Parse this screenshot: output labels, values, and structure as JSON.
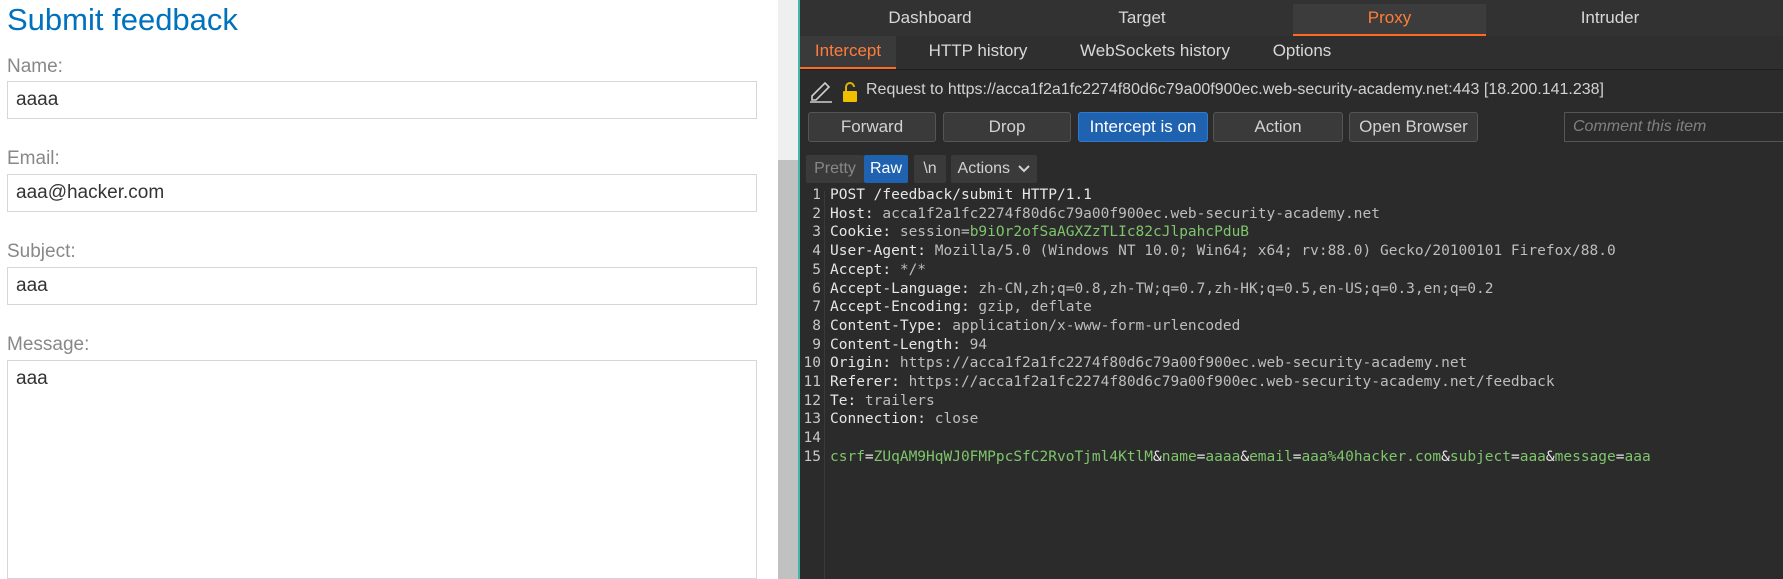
{
  "form": {
    "title": "Submit feedback",
    "name_label": "Name:",
    "name_value": "aaaa",
    "email_label": "Email:",
    "email_value": "aaa@hacker.com",
    "subject_label": "Subject:",
    "subject_value": "aaa",
    "message_label": "Message:",
    "message_value": "aaa"
  },
  "burp": {
    "main_tabs": [
      "Dashboard",
      "Target",
      "Proxy",
      "Intruder"
    ],
    "active_main_tab": "Proxy",
    "sub_tabs": [
      "Intercept",
      "HTTP history",
      "WebSockets history",
      "Options"
    ],
    "active_sub_tab": "Intercept",
    "request_info": "Request to https://acca1f2a1fc2274f80d6c79a00f900ec.web-security-academy.net:443  [18.200.141.238]",
    "buttons": {
      "forward": "Forward",
      "drop": "Drop",
      "intercept": "Intercept is on",
      "action": "Action",
      "open_browser": "Open Browser"
    },
    "comment_placeholder": "Comment this item",
    "editor_buttons": {
      "pretty": "Pretty",
      "raw": "Raw",
      "newline": "\\n",
      "actions": "Actions"
    },
    "request_lines": [
      {
        "n": "1",
        "key": "POST /feedback/submit HTTP/1.1",
        "val": ""
      },
      {
        "n": "2",
        "key": "Host:",
        "val": " acca1f2a1fc2274f80d6c79a00f900ec.web-security-academy.net"
      },
      {
        "n": "3",
        "key": "Cookie:",
        "val": " session=",
        "cookie": "b9iOr2ofSaAGXZzTLIc82cJlpahcPduB"
      },
      {
        "n": "4",
        "key": "User-Agent:",
        "val": " Mozilla/5.0 (Windows NT 10.0; Win64; x64; rv:88.0) Gecko/20100101 Firefox/88.0"
      },
      {
        "n": "5",
        "key": "Accept:",
        "val": " */*"
      },
      {
        "n": "6",
        "key": "Accept-Language:",
        "val": " zh-CN,zh;q=0.8,zh-TW;q=0.7,zh-HK;q=0.5,en-US;q=0.3,en;q=0.2"
      },
      {
        "n": "7",
        "key": "Accept-Encoding:",
        "val": " gzip, deflate"
      },
      {
        "n": "8",
        "key": "Content-Type:",
        "val": " application/x-www-form-urlencoded"
      },
      {
        "n": "9",
        "key": "Content-Length:",
        "val": " 94"
      },
      {
        "n": "10",
        "key": "Origin:",
        "val": " https://acca1f2a1fc2274f80d6c79a00f900ec.web-security-academy.net"
      },
      {
        "n": "11",
        "key": "Referer:",
        "val": " https://acca1f2a1fc2274f80d6c79a00f900ec.web-security-academy.net/feedback"
      },
      {
        "n": "12",
        "key": "Te:",
        "val": " trailers"
      },
      {
        "n": "13",
        "key": "Connection:",
        "val": " close"
      },
      {
        "n": "14",
        "key": "",
        "val": ""
      }
    ],
    "body_line_number": "15",
    "body_params": [
      {
        "k": "csrf",
        "v": "ZUqAM9HqWJ0FMPpcSfC2RvoTjml4KtlM"
      },
      {
        "k": "name",
        "v": "aaaa"
      },
      {
        "k": "email",
        "v": "aaa%40hacker.com"
      },
      {
        "k": "subject",
        "v": "aaa"
      },
      {
        "k": "message",
        "v": "aaa"
      }
    ],
    "colors": {
      "accent_orange": "#ff6a21",
      "button_blue": "#1f63b0",
      "param_green": "#7ec56c",
      "form_title_blue": "#0071bc"
    }
  }
}
